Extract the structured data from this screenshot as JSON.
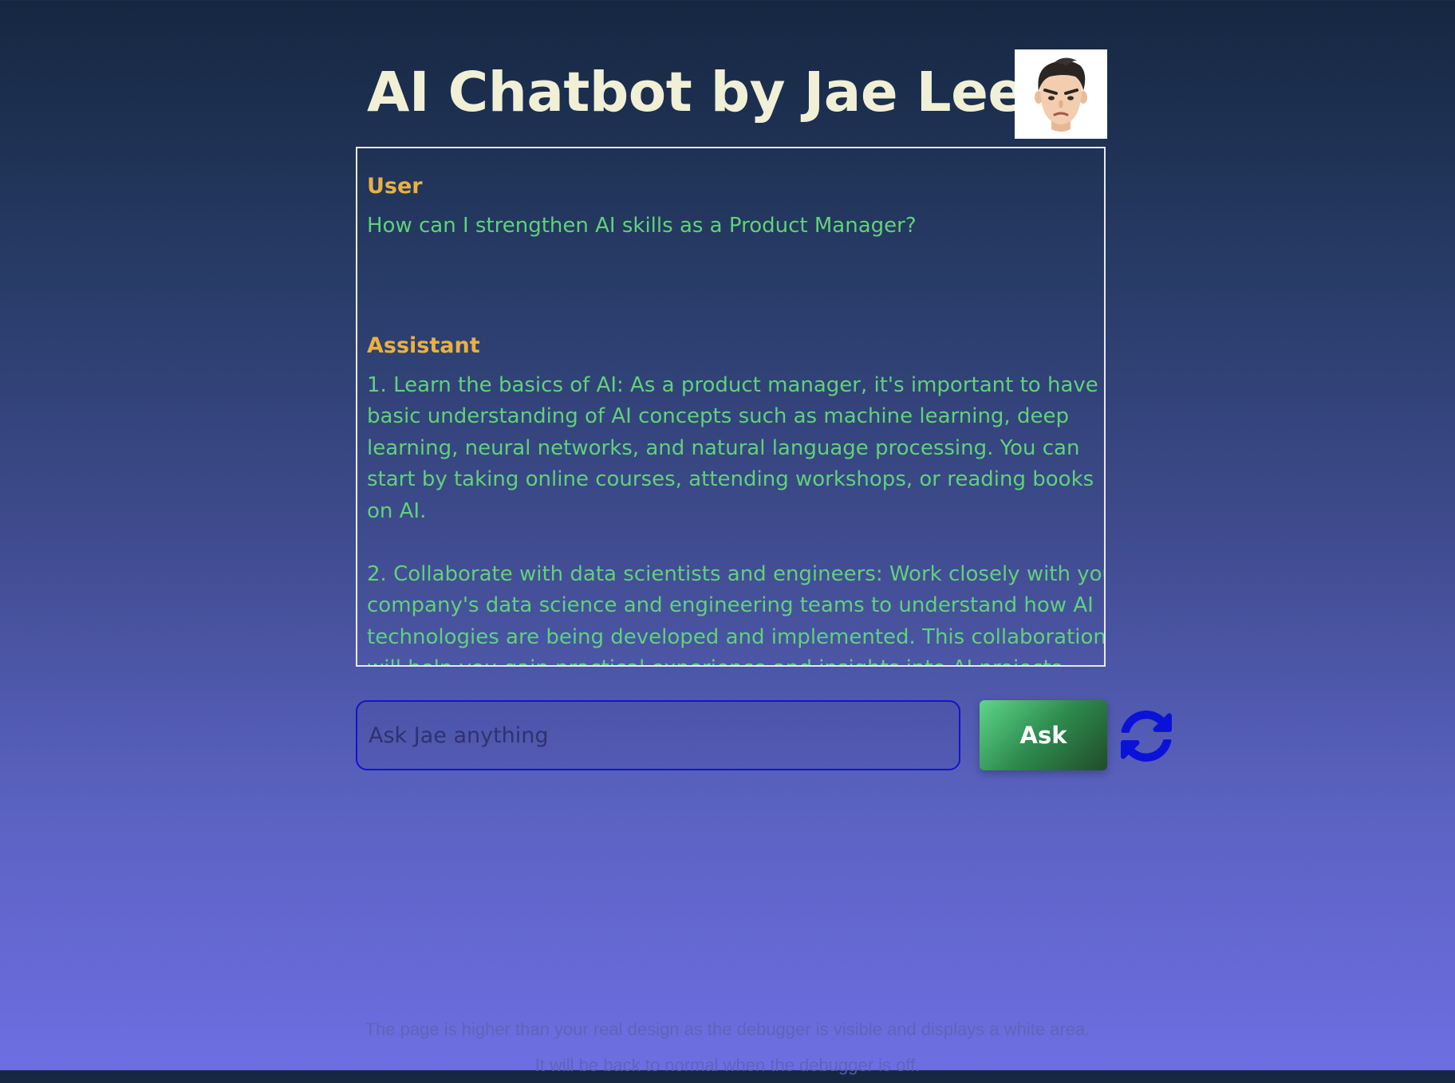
{
  "header": {
    "title": "AI Chatbot by Jae Lee",
    "avatar_icon": "memoji-avatar-icon"
  },
  "chat": {
    "messages": [
      {
        "role": "User",
        "text": "How can I strengthen AI skills as a Product Manager?"
      },
      {
        "role": "Assistant",
        "text": "1. Learn the basics of AI: As a product manager, it's important to have a basic understanding of AI concepts such as machine learning, deep learning, neural networks, and natural language processing. You can start by taking online courses, attending workshops, or reading books on AI.\n\n2. Collaborate with data scientists and engineers: Work closely with your company's data science and engineering teams to understand how AI technologies are being developed and implemented. This collaboration will help you gain practical experience and insights into AI projects."
      }
    ]
  },
  "input": {
    "placeholder": "Ask Jae anything",
    "value": ""
  },
  "buttons": {
    "ask_label": "Ask",
    "refresh_icon": "refresh-icon"
  },
  "footer": {
    "line1": "The page is higher than your real design as the debugger is visible and displays a white area.",
    "line2": "It will be back to normal when the debugger is off."
  },
  "colors": {
    "title": "#f1f0d6",
    "role_label": "#eab040",
    "message_text": "#5fd27a",
    "input_border": "#1414c8",
    "ask_button": "#2e8a4e",
    "refresh_icon": "#0a12d8"
  }
}
